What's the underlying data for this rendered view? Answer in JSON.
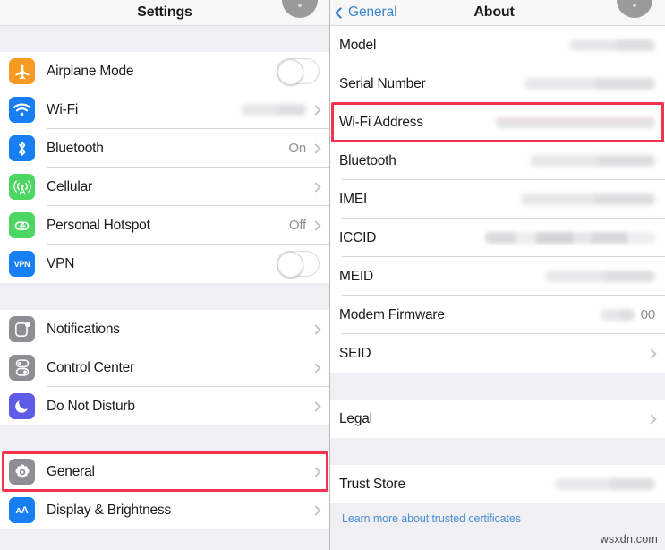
{
  "left_pane": {
    "nav": {
      "title": "Settings"
    },
    "sections": [
      {
        "rows": [
          {
            "label": "Airplane Mode",
            "icon": "airplane-icon",
            "icon_color": "#f79a23",
            "control": "toggle",
            "toggle_on": false
          },
          {
            "label": "Wi-Fi",
            "icon": "wifi-icon",
            "icon_color": "#187ff2",
            "control": "chevron",
            "value": "",
            "redacted": true,
            "redact_width": 72
          },
          {
            "label": "Bluetooth",
            "icon": "bluetooth-icon",
            "icon_color": "#187ff2",
            "control": "chevron",
            "value": "On"
          },
          {
            "label": "Cellular",
            "icon": "cellular-icon",
            "icon_color": "#4cd664",
            "control": "chevron",
            "value": ""
          },
          {
            "label": "Personal Hotspot",
            "icon": "hotspot-icon",
            "icon_color": "#4cd664",
            "control": "chevron",
            "value": "Off"
          },
          {
            "label": "VPN",
            "icon": "vpn-icon",
            "icon_color": "#187ff2",
            "control": "toggle",
            "toggle_on": false
          }
        ]
      },
      {
        "rows": [
          {
            "label": "Notifications",
            "icon": "notifications-icon",
            "icon_color": "#8e8e93",
            "control": "chevron",
            "value": ""
          },
          {
            "label": "Control Center",
            "icon": "control-center-icon",
            "icon_color": "#8e8e93",
            "control": "chevron",
            "value": ""
          },
          {
            "label": "Do Not Disturb",
            "icon": "moon-icon",
            "icon_color": "#5e5ce6",
            "control": "chevron",
            "value": ""
          }
        ]
      },
      {
        "rows": [
          {
            "label": "General",
            "icon": "gear-icon",
            "icon_color": "#8e8e93",
            "control": "chevron",
            "value": "",
            "highlighted": true
          },
          {
            "label": "Display & Brightness",
            "icon": "display-brightness-icon",
            "icon_color": "#187ff2",
            "control": "chevron",
            "value": ""
          }
        ]
      }
    ]
  },
  "right_pane": {
    "nav": {
      "back_label": "General",
      "title": "About"
    },
    "sections": [
      {
        "rows": [
          {
            "label": "Model",
            "redacted": true,
            "redact_width": 96,
            "control": "none"
          },
          {
            "label": "Serial Number",
            "redacted": true,
            "redact_width": 146,
            "control": "none"
          },
          {
            "label": "Wi-Fi Address",
            "redacted": true,
            "redact_width": 178,
            "control": "none",
            "highlighted": true
          },
          {
            "label": "Bluetooth",
            "redacted": true,
            "redact_width": 140,
            "control": "none"
          },
          {
            "label": "IMEI",
            "redacted": true,
            "redact_width": 150,
            "control": "none"
          },
          {
            "label": "ICCID",
            "redacted": true,
            "redact_width": 190,
            "control": "none"
          },
          {
            "label": "MEID",
            "redacted": true,
            "redact_width": 122,
            "control": "none"
          },
          {
            "label": "Modem Firmware",
            "redacted": true,
            "redact_width": 38,
            "value": "00",
            "control": "none"
          },
          {
            "label": "SEID",
            "control": "chevron",
            "value": ""
          }
        ]
      },
      {
        "rows": [
          {
            "label": "Legal",
            "control": "chevron",
            "value": ""
          }
        ]
      },
      {
        "rows": [
          {
            "label": "Trust Store",
            "redacted": true,
            "redact_width": 112,
            "control": "none"
          }
        ]
      }
    ],
    "footer_link": "Learn more about trusted certificates"
  },
  "watermark": "wsxdn.com",
  "colors": {
    "highlight": "#f5334f",
    "link": "#4a8fd4",
    "nav_tint": "#3b86d2",
    "value_gray": "#8e8e93"
  }
}
